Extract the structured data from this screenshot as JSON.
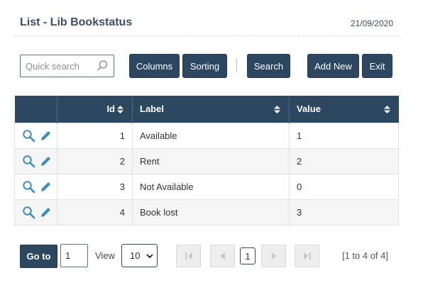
{
  "header": {
    "title": "List - Lib Bookstatus",
    "date": "21/09/2020"
  },
  "toolbar": {
    "search_placeholder": "Quick search",
    "columns_label": "Columns",
    "sorting_label": "Sorting",
    "search_label": "Search",
    "add_new_label": "Add New",
    "exit_label": "Exit"
  },
  "table": {
    "headers": {
      "id": "Id",
      "label": "Label",
      "value": "Value"
    },
    "rows": [
      {
        "id": "1",
        "label": "Available",
        "value": "1"
      },
      {
        "id": "2",
        "label": "Rent",
        "value": "2"
      },
      {
        "id": "3",
        "label": "Not Available",
        "value": "0"
      },
      {
        "id": "4",
        "label": "Book lost",
        "value": "3"
      }
    ]
  },
  "pagination": {
    "goto_label": "Go to",
    "page_value": "1",
    "view_label": "View",
    "view_value": "10",
    "current_page": "1",
    "range_text": "[1 to 4 of 4]"
  },
  "colors": {
    "primary": "#2e4760",
    "icon_teal": "#3a8fb7"
  }
}
